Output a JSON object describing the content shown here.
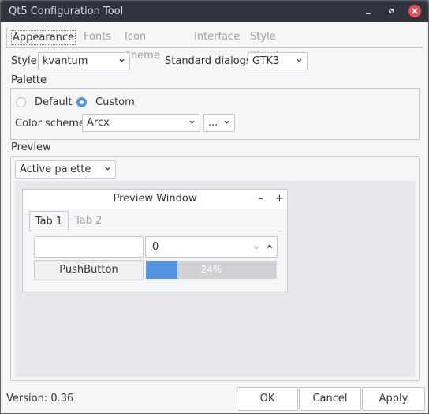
{
  "window": {
    "title": "Qt5 Configuration Tool"
  },
  "tabs": [
    "Appearance",
    "Fonts",
    "Icon Theme",
    "Interface",
    "Style Sheets"
  ],
  "appearance": {
    "style_label": "Style:",
    "style_value": "kvantum",
    "std_dialogs_label": "Standard dialogs:",
    "std_dialogs_value": "GTK3",
    "palette_label": "Palette",
    "radio_default": "Default",
    "radio_custom": "Custom",
    "color_scheme_label": "Color scheme:",
    "color_scheme_value": "Arcx",
    "more_button": "...",
    "preview_label": "Preview",
    "palette_combo": "Active palette"
  },
  "preview_window": {
    "title": "Preview Window",
    "minimize": "–",
    "maximize": "+",
    "tab1": "Tab 1",
    "tab2": "Tab 2",
    "spin_value": "0",
    "push_button": "PushButton",
    "progress_text": "24%",
    "progress_fraction": 0.24
  },
  "footer": {
    "version": "Version: 0.36",
    "ok": "OK",
    "cancel": "Cancel",
    "apply": "Apply"
  },
  "colors": {
    "accent": "#5294e2",
    "titlebar": "#2f343f",
    "close": "#e0545d"
  }
}
